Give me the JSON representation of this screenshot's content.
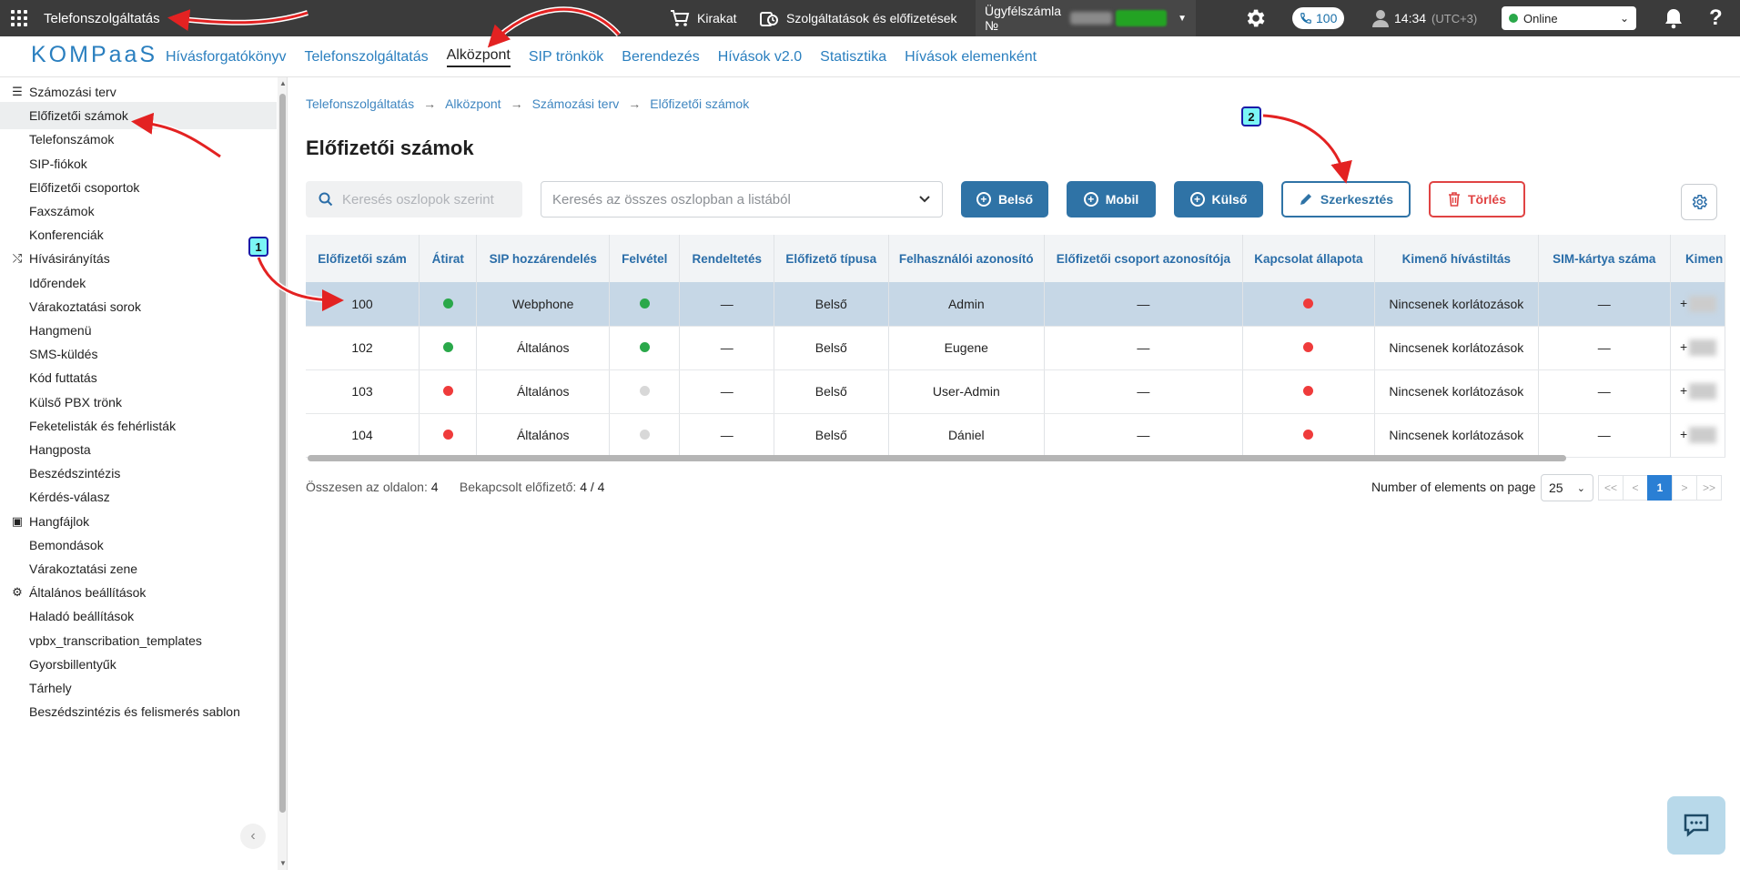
{
  "topbar": {
    "title": "Telefonszolgáltatás",
    "shop": "Kirakat",
    "services": "Szolgáltatások és előfizetések",
    "account_label": "Ügyfélszámla №",
    "calls_badge": "100",
    "time": "14:34",
    "timezone": "(UTC+3)",
    "status": "Online",
    "help": "?"
  },
  "logo": "KOMPaaS",
  "nav": {
    "items": [
      "Hívásforgatókönyv",
      "Telefonszolgáltatás",
      "Alközpont",
      "SIP trönkök",
      "Berendezés",
      "Hívások v2.0",
      "Statisztika",
      "Hívások elemenként"
    ],
    "active": "Alközpont"
  },
  "sidebar": {
    "items": [
      {
        "label": "Számozási terv",
        "type": "head",
        "icon": "list-icon"
      },
      {
        "label": "Előfizetői számok",
        "type": "sel"
      },
      {
        "label": "Telefonszámok"
      },
      {
        "label": "SIP-fiókok"
      },
      {
        "label": "Előfizetői csoportok"
      },
      {
        "label": "Faxszámok"
      },
      {
        "label": "Konferenciák"
      },
      {
        "label": "Hívásirányítás",
        "type": "head",
        "icon": "routing-icon"
      },
      {
        "label": "Időrendek"
      },
      {
        "label": "Várakoztatási sorok"
      },
      {
        "label": "Hangmenü"
      },
      {
        "label": "SMS-küldés"
      },
      {
        "label": "Kód futtatás"
      },
      {
        "label": "Külső PBX trönk"
      },
      {
        "label": "Feketelisták és fehérlisták"
      },
      {
        "label": "Hangposta"
      },
      {
        "label": "Beszédszintézis"
      },
      {
        "label": "Kérdés-válasz"
      },
      {
        "label": "Hangfájlok",
        "type": "head",
        "icon": "audio-files-icon"
      },
      {
        "label": "Bemondások"
      },
      {
        "label": "Várakoztatási zene"
      },
      {
        "label": "Általános beállítások",
        "type": "head",
        "icon": "gear-icon"
      },
      {
        "label": "Haladó beállítások"
      },
      {
        "label": "vpbx_transcribation_templates"
      },
      {
        "label": "Gyorsbillentyűk"
      },
      {
        "label": "Tárhely"
      },
      {
        "label": "Beszédszintézis és felismerés sablon"
      }
    ]
  },
  "breadcrumb": [
    "Telefonszolgáltatás",
    "Alközpont",
    "Számozási terv",
    "Előfizetői számok"
  ],
  "breadcrumb_sep": "→",
  "page_title": "Előfizetői számok",
  "toolbar": {
    "search_placeholder": "Keresés oszlopok szerint",
    "search_all_placeholder": "Keresés az összes oszlopban a listából",
    "btn_internal": "Belső",
    "btn_mobile": "Mobil",
    "btn_external": "Külső",
    "btn_edit": "Szerkesztés",
    "btn_delete": "Törlés"
  },
  "table": {
    "columns": [
      "Előfizetői szám",
      "Átirat",
      "SIP hozzárendelés",
      "Felvétel",
      "Rendeltetés",
      "Előfizető típusa",
      "Felhasználói azonosító",
      "Előfizetői csoport azonosítója",
      "Kapcsolat állapota",
      "Kimenő hívástiltás",
      "SIM-kártya száma",
      "Kimen"
    ],
    "rows": [
      {
        "number": "100",
        "transcript": "green",
        "sip": "Webphone",
        "recording": "green",
        "purpose": "—",
        "type": "Belső",
        "user": "Admin",
        "group": "—",
        "connection": "red",
        "outgoing": "Nincsenek korlátozások",
        "sim": "—",
        "last": "+"
      },
      {
        "number": "102",
        "transcript": "green",
        "sip": "Általános",
        "recording": "green",
        "purpose": "—",
        "type": "Belső",
        "user": "Eugene",
        "group": "—",
        "connection": "red",
        "outgoing": "Nincsenek korlátozások",
        "sim": "—",
        "last": "+"
      },
      {
        "number": "103",
        "transcript": "red",
        "sip": "Általános",
        "recording": "gray",
        "purpose": "—",
        "type": "Belső",
        "user": "User-Admin",
        "group": "—",
        "connection": "red",
        "outgoing": "Nincsenek korlátozások",
        "sim": "—",
        "last": "+"
      },
      {
        "number": "104",
        "transcript": "red",
        "sip": "Általános",
        "recording": "gray",
        "purpose": "—",
        "type": "Belső",
        "user": "Dániel",
        "group": "—",
        "connection": "red",
        "outgoing": "Nincsenek korlátozások",
        "sim": "—",
        "last": "+"
      }
    ],
    "selected_row": 0
  },
  "footer": {
    "total_label": "Összesen az oldalon:",
    "total_value": "4",
    "enabled_label": "Bekapcsolt előfizető:",
    "enabled_value": "4 / 4",
    "page_size_label": "Number of elements on page",
    "page_size": "25",
    "pager": [
      "<<",
      "<",
      "1",
      ">",
      ">>"
    ],
    "current_page": "1"
  },
  "annotations": [
    "1",
    "2"
  ],
  "colors": {
    "green": "#2aa84a",
    "red": "#ef3b3b",
    "gray": "#d8d8d8",
    "accent": "#2f73a6",
    "danger": "#e04343"
  }
}
